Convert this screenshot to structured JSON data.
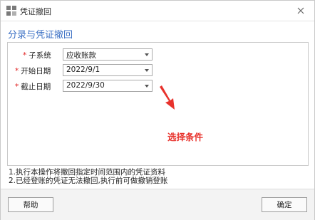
{
  "window": {
    "title": "凭证撤回",
    "close_icon": "close-icon",
    "app_icon": "grid-app-icon"
  },
  "header": {
    "section_title": "分录与凭证撤回"
  },
  "form": {
    "required_mark": "*",
    "fields": [
      {
        "label": "子系统",
        "value": "应收账款"
      },
      {
        "label": "开始日期",
        "value": "2022/9/1"
      },
      {
        "label": "截止日期",
        "value": "2022/9/30"
      }
    ]
  },
  "annotation": {
    "text": "选择条件",
    "color": "#e8322c"
  },
  "notes": [
    "1.执行本操作将撤回指定时间范围内的凭证资料",
    "2.已经登账的凭证无法撤回,执行前可做撤销登账"
  ],
  "footer": {
    "help_label": "帮助",
    "ok_label": "确定"
  },
  "colors": {
    "accent": "#3a6fc4",
    "required": "#e02020"
  }
}
